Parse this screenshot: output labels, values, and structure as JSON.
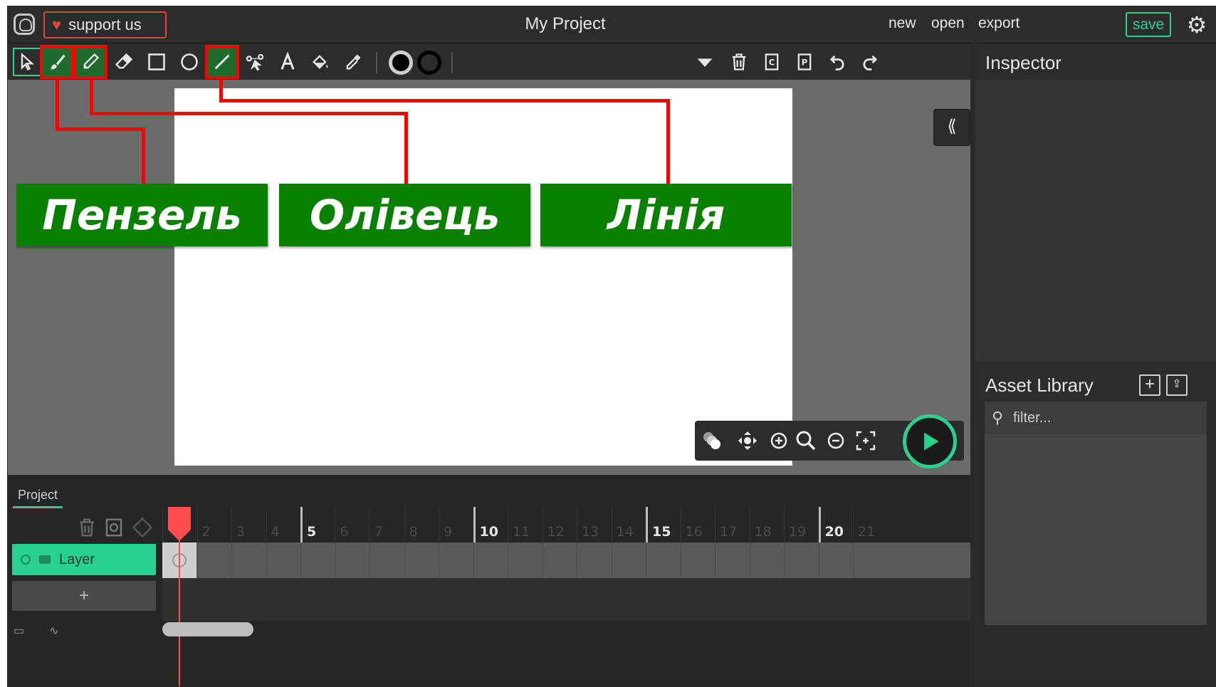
{
  "topbar": {
    "support_label": "support us",
    "project_title": "My Project",
    "menu": {
      "new": "new",
      "open": "open",
      "export": "export",
      "save": "save"
    }
  },
  "toolbar": {
    "tools": [
      "select",
      "brush",
      "pencil",
      "eraser",
      "rectangle",
      "ellipse",
      "line",
      "path",
      "text",
      "fill",
      "eyedropper"
    ],
    "active_tool": "select",
    "fill_color": "#000000",
    "stroke_color": "#000000"
  },
  "callouts": {
    "brush": "Пензель",
    "pencil": "Олівець",
    "line": "Лінія"
  },
  "inspector": {
    "title": "Inspector"
  },
  "assets": {
    "title": "Asset Library",
    "filter_placeholder": "filter..."
  },
  "timeline": {
    "tab": "Project",
    "layer_name": "Layer",
    "add_layer_label": "+",
    "frame_numbers": [
      "",
      "2",
      "3",
      "4",
      "5",
      "6",
      "7",
      "8",
      "9",
      "10",
      "11",
      "12",
      "13",
      "14",
      "15",
      "16",
      "17",
      "18",
      "19",
      "20",
      "21"
    ],
    "major_frames": [
      "5",
      "10",
      "15",
      "20"
    ],
    "current_frame": 1
  },
  "colors": {
    "accent": "#2ad08e",
    "highlight": "#ff0000",
    "callout_bg": "#0a8000",
    "support": "#e0473a"
  }
}
